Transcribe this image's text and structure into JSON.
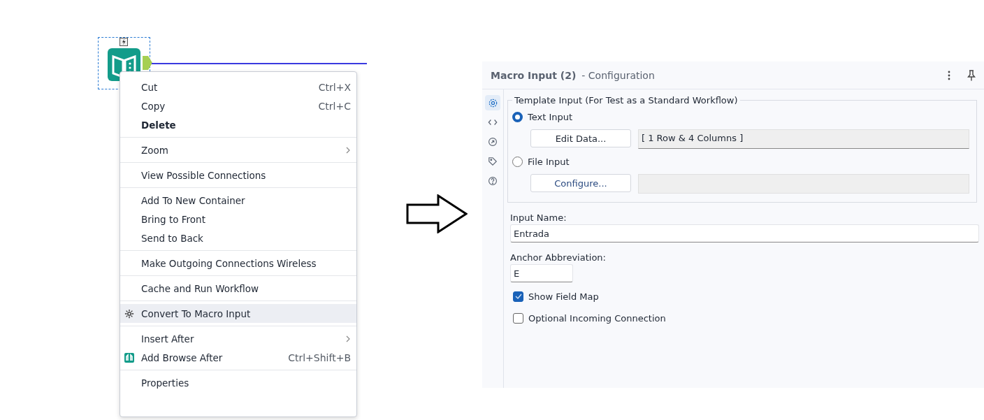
{
  "canvas": {
    "node": {
      "selected": true
    }
  },
  "context_menu": {
    "groups": [
      [
        {
          "label": "Cut",
          "shortcut": "Ctrl+X",
          "bold": false,
          "submenu": false,
          "selected": false,
          "kind": "plain"
        },
        {
          "label": "Copy",
          "shortcut": "Ctrl+C",
          "bold": false,
          "submenu": false,
          "selected": false,
          "kind": "plain"
        },
        {
          "label": "Delete",
          "bold": true,
          "submenu": false,
          "selected": false,
          "kind": "plain"
        }
      ],
      [
        {
          "label": "Zoom",
          "bold": false,
          "submenu": true,
          "selected": false,
          "kind": "plain"
        }
      ],
      [
        {
          "label": "View Possible Connections",
          "bold": false,
          "submenu": false,
          "selected": false,
          "kind": "plain"
        }
      ],
      [
        {
          "label": "Add To New Container",
          "bold": false,
          "submenu": false,
          "selected": false,
          "kind": "plain"
        },
        {
          "label": "Bring to Front",
          "bold": false,
          "submenu": false,
          "selected": false,
          "kind": "plain"
        },
        {
          "label": "Send to Back",
          "bold": false,
          "submenu": false,
          "selected": false,
          "kind": "plain"
        }
      ],
      [
        {
          "label": "Make Outgoing Connections Wireless",
          "bold": false,
          "submenu": false,
          "selected": false,
          "kind": "plain"
        }
      ],
      [
        {
          "label": "Cache and Run Workflow",
          "bold": false,
          "submenu": false,
          "selected": false,
          "kind": "plain"
        }
      ],
      [
        {
          "label": "Convert To Macro Input",
          "bold": false,
          "submenu": false,
          "selected": true,
          "kind": "convert"
        }
      ],
      [
        {
          "label": "Insert After",
          "bold": false,
          "submenu": true,
          "selected": false,
          "kind": "plain"
        },
        {
          "label": "Add Browse After",
          "shortcut": "Ctrl+Shift+B",
          "bold": false,
          "submenu": false,
          "selected": false,
          "kind": "browse"
        }
      ],
      [
        {
          "label": "Properties",
          "bold": false,
          "submenu": false,
          "selected": false,
          "kind": "plain"
        }
      ]
    ]
  },
  "panel": {
    "title": "Macro Input (2)",
    "subtitle": "- Configuration",
    "side_tabs": [
      {
        "selected": true
      },
      {
        "selected": false
      },
      {
        "selected": false
      },
      {
        "selected": false
      },
      {
        "selected": false
      }
    ],
    "template": {
      "legend": "Template Input (For Test as a Standard Workflow)",
      "options": [
        {
          "label": "Text Input",
          "selected": true,
          "button": "Edit Data...",
          "value": "[ 1 Row & 4 Columns ]"
        },
        {
          "label": "File Input",
          "selected": false,
          "button": "Configure..."
        }
      ]
    },
    "input_name": {
      "label": "Input Name:",
      "value": "Entrada"
    },
    "anchor": {
      "label": "Anchor Abbreviation:",
      "value": "E"
    },
    "checkboxes": [
      {
        "label": "Show Field Map",
        "checked": true
      },
      {
        "label": "Optional Incoming Connection",
        "checked": false
      }
    ]
  }
}
